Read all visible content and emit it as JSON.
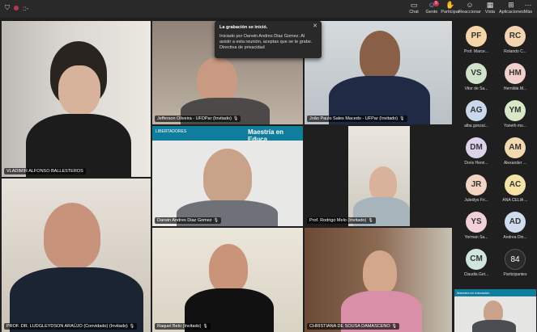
{
  "topbar": {
    "timer": "::-",
    "buttons": [
      {
        "icon": "chat-icon",
        "label": "Chat"
      },
      {
        "icon": "people-icon",
        "label": "Gente",
        "badge": "5"
      },
      {
        "icon": "raise-hand-icon",
        "label": "Participar"
      },
      {
        "icon": "react-icon",
        "label": "Reaccionar"
      },
      {
        "icon": "view-icon",
        "label": "Vista"
      },
      {
        "icon": "apps-icon",
        "label": "Aplicaciones"
      },
      {
        "icon": "more-icon",
        "label": "Más"
      }
    ]
  },
  "toast": {
    "title": "La grabación se inició.",
    "body": "Iniciado por Darwin Andres Diaz Gomez. Al asistir a esta reunión, aceptas que se te grabe. Directiva de privacidad"
  },
  "tiles": [
    {
      "name": "VLADIMIR ALFONSO BALLESTEROS"
    },
    {
      "name": "Jefferson Oliveira - UFDPar (Invitado)"
    },
    {
      "name": "João Paulo Sales Macedo - UFPar (Invitado)"
    },
    {
      "name": "Darwin Andres Diaz Gomez",
      "banner": "Maestría en Educa",
      "logo": "LIBERTADORES"
    },
    {
      "name": "Prof. Rodrigo Melo (Invitado)"
    },
    {
      "name": "PROF. DR. LUDGLEYDSON ARAÚJO (Convidado) (Invitado)"
    },
    {
      "name": "Raquel Belo (Invitado)"
    },
    {
      "name": "CHRISTIANA DE SOUSA DAMASCENO"
    }
  ],
  "roster": [
    {
      "initials": "PF",
      "name": "Prof. Marce...",
      "color": "#f6d6a8"
    },
    {
      "initials": "RC",
      "name": "Rolando C...",
      "color": "#f2d4b0"
    },
    {
      "initials": "VS",
      "name": "Vitor de Sa...",
      "color": "#cfe3c9"
    },
    {
      "initials": "HM",
      "name": "Hernilda M...",
      "color": "#f2d0cd"
    },
    {
      "initials": "AG",
      "name": "alba gonzal...",
      "color": "#c9d8ea"
    },
    {
      "initials": "YM",
      "name": "Yaneth mo...",
      "color": "#d7e8c4"
    },
    {
      "initials": "DM",
      "name": "Doris Henri...",
      "color": "#dcd3ea"
    },
    {
      "initials": "AM",
      "name": "Alexander ...",
      "color": "#f3d8b0"
    },
    {
      "initials": "JR",
      "name": "Juleidys Fri...",
      "color": "#f2d4c2"
    },
    {
      "initials": "AC",
      "name": "ANA CELIA ...",
      "color": "#f5e3a6"
    },
    {
      "initials": "YS",
      "name": "Yorman Sa...",
      "color": "#f2d0d8"
    },
    {
      "initials": "AD",
      "name": "Andrea Din...",
      "color": "#cfdcee"
    },
    {
      "initials": "CM",
      "name": "Claudia Get...",
      "color": "#cfe6dc"
    },
    {
      "initials": "84",
      "name": "Participantes",
      "color": "#2b2b2b"
    }
  ],
  "mini_tile": {
    "banner": "Maestría en educación"
  }
}
